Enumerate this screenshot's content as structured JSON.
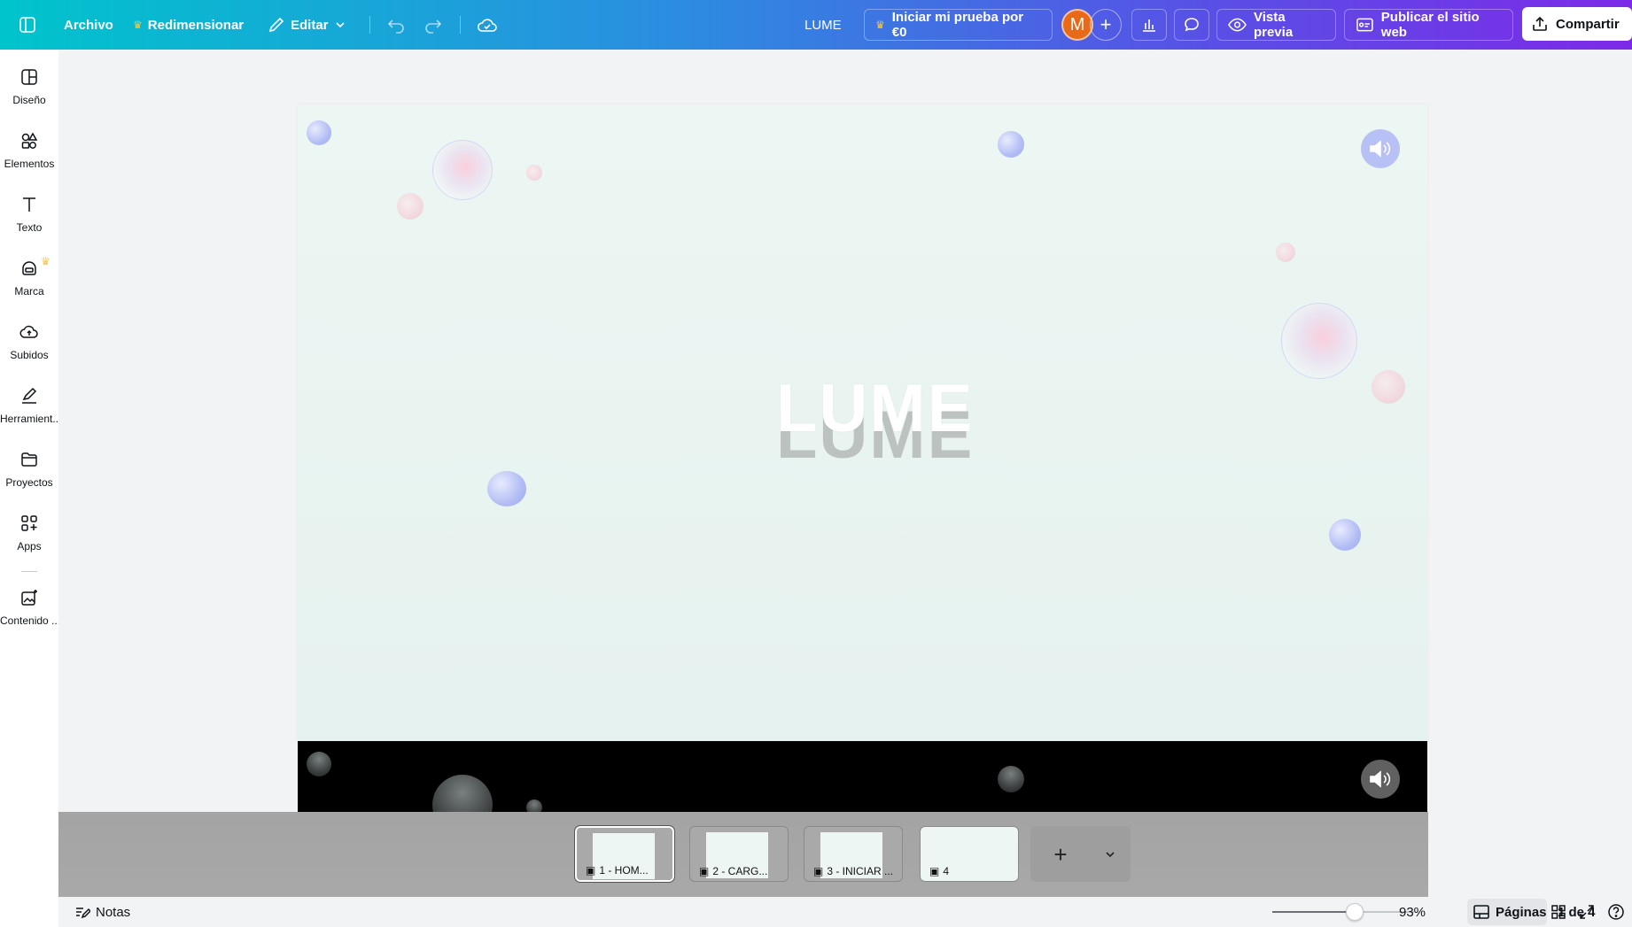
{
  "topbar": {
    "file_label": "Archivo",
    "resize_label": "Redimensionar",
    "edit_label": "Editar",
    "doc_title": "LUME",
    "trial_label": "Iniciar mi prueba por €0",
    "avatar_initial": "M",
    "preview_label": "Vista previa",
    "publish_label": "Publicar el sitio web",
    "share_label": "Compartir"
  },
  "sidebar": {
    "items": [
      {
        "label": "Diseño",
        "icon": "layout-icon"
      },
      {
        "label": "Elementos",
        "icon": "shapes-icon"
      },
      {
        "label": "Texto",
        "icon": "text-icon"
      },
      {
        "label": "Marca",
        "icon": "brand-icon",
        "badge": "crown"
      },
      {
        "label": "Subidos",
        "icon": "cloud-upload-icon"
      },
      {
        "label": "Herramient...",
        "icon": "pen-tool-icon"
      },
      {
        "label": "Proyectos",
        "icon": "folder-icon"
      },
      {
        "label": "Apps",
        "icon": "apps-grid-icon"
      },
      {
        "label": "Contenido ...",
        "icon": "magic-media-icon"
      }
    ]
  },
  "canvas": {
    "title_text": "LUME"
  },
  "pages": [
    {
      "label": "1 - HOM..."
    },
    {
      "label": "2 - CARG..."
    },
    {
      "label": "3 - INICIAR ..."
    },
    {
      "label": "4"
    }
  ],
  "bottombar": {
    "notes_label": "Notas",
    "zoom_value": "93%",
    "zoom_fraction": 0.58,
    "pages_label": "Páginas",
    "page_counter": "1 de 4"
  },
  "colors": {
    "gradient_start": "#00c4cc",
    "gradient_end": "#7d2ae8",
    "avatar": "#e86a19",
    "crown": "#ffc633"
  }
}
